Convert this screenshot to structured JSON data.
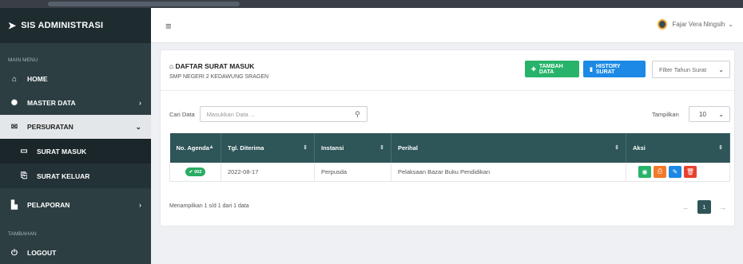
{
  "brand": {
    "logo_icon": "paper-plane-icon",
    "label": "SIS ADMINISTRASI"
  },
  "sidebar": {
    "section_main": "MAIN MENU",
    "section_extra": "TAMBAHAN",
    "items": [
      {
        "label": "HOME",
        "icon": "home-icon"
      },
      {
        "label": "MASTER DATA",
        "icon": "gear-icon"
      },
      {
        "label": "PERSURATAN",
        "icon": "mail-icon"
      },
      {
        "label": "SURAT MASUK",
        "icon": "inbox-icon"
      },
      {
        "label": "SURAT KELUAR",
        "icon": "outbox-icon"
      },
      {
        "label": "PELAPORAN",
        "icon": "chart-icon"
      },
      {
        "label": "LOGOUT",
        "icon": "power-icon"
      }
    ]
  },
  "topbar": {
    "user_name": "Fajar Vera Ningsih"
  },
  "card": {
    "title": "DAFTAR SURAT MASUK",
    "subtitle": "SMP NEGERI 2 KEDAWUNG SRAGEN",
    "add_label": "TAMBAH DATA",
    "history_label": "HISTORY SURAT",
    "filter_placeholder": "Filter Tahun Surat"
  },
  "search": {
    "label": "Cari Data",
    "placeholder": "Masukkan Data ..."
  },
  "length": {
    "label": "Tampilkan",
    "value": "10"
  },
  "table": {
    "headers": [
      "No. Agenda",
      "Tgl. Diterima",
      "Instansi",
      "Perihal",
      "Aksi"
    ],
    "rows": [
      {
        "agenda": "002",
        "date": "2022-08-17",
        "instansi": "Perpusda",
        "perihal": "Pelaksaan Bazar Buku Pendidikan"
      }
    ]
  },
  "footer": {
    "info": "Menampilkan 1 s/d 1 dari 1 data",
    "page": "1"
  },
  "colors": {
    "sidebar": "#2c3e42",
    "header": "#2e5558",
    "green": "#28b36a",
    "blue": "#1b89e5",
    "orange": "#f27a2a",
    "red": "#e8412e"
  }
}
